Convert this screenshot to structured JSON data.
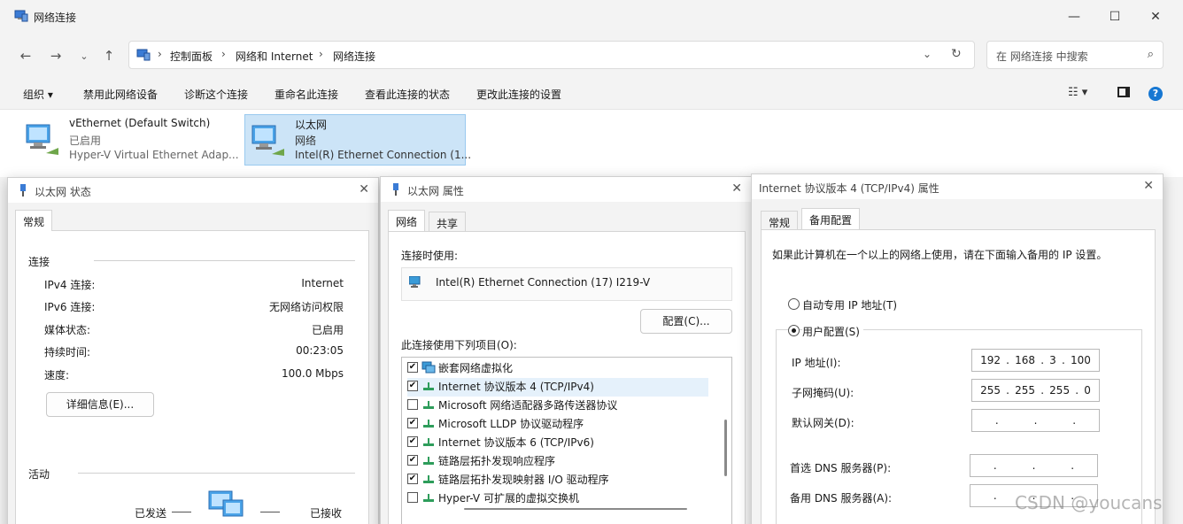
{
  "window": {
    "title": "网络连接",
    "minimize_icon": "minimize-icon",
    "maximize_icon": "maximize-icon",
    "close_icon": "close-icon"
  },
  "address": {
    "breadcrumbs": [
      "控制面板",
      "网络和 Internet",
      "网络连接"
    ],
    "search_placeholder": "在 网络连接 中搜索"
  },
  "toolbar": {
    "items": [
      "组织 ▾",
      "禁用此网络设备",
      "诊断这个连接",
      "重命名此连接",
      "查看此连接的状态",
      "更改此连接的设置"
    ]
  },
  "connections": [
    {
      "name": "vEthernet (Default Switch)",
      "status": "已启用",
      "device": "Hyper-V Virtual Ethernet Adap..."
    },
    {
      "name": "以太网",
      "status": "网络",
      "device": "Intel(R) Ethernet Connection (1..."
    }
  ],
  "status_dialog": {
    "title": "以太网 状态",
    "tab": "常规",
    "connection_group": "连接",
    "rows": [
      {
        "label": "IPv4 连接:",
        "value": "Internet"
      },
      {
        "label": "IPv6 连接:",
        "value": "无网络访问权限"
      },
      {
        "label": "媒体状态:",
        "value": "已启用"
      },
      {
        "label": "持续时间:",
        "value": "00:23:05"
      },
      {
        "label": "速度:",
        "value": "100.0 Mbps"
      }
    ],
    "details_button": "详细信息(E)...",
    "activity_group": "活动",
    "sent_label": "已发送",
    "received_label": "已接收"
  },
  "properties_dialog": {
    "title": "以太网 属性",
    "tabs": [
      "网络",
      "共享"
    ],
    "connect_using_label": "连接时使用:",
    "adapter": "Intel(R) Ethernet Connection (17) I219-V",
    "configure_button": "配置(C)...",
    "items_label": "此连接使用下列项目(O):",
    "items": [
      {
        "checked": true,
        "label": "嵌套网络虚拟化"
      },
      {
        "checked": true,
        "label": "Internet 协议版本 4 (TCP/IPv4)"
      },
      {
        "checked": false,
        "label": "Microsoft 网络适配器多路传送器协议"
      },
      {
        "checked": true,
        "label": "Microsoft LLDP 协议驱动程序"
      },
      {
        "checked": true,
        "label": "Internet 协议版本 6 (TCP/IPv6)"
      },
      {
        "checked": true,
        "label": "链路层拓扑发现响应程序"
      },
      {
        "checked": true,
        "label": "链路层拓扑发现映射器 I/O 驱动程序"
      },
      {
        "checked": false,
        "label": "Hyper-V 可扩展的虚拟交换机"
      }
    ]
  },
  "ipv4_dialog": {
    "title": "Internet 协议版本 4 (TCP/IPv4) 属性",
    "tabs": [
      "常规",
      "备用配置"
    ],
    "description": "如果此计算机在一个以上的网络上使用，请在下面输入备用的 IP 设置。",
    "auto_option": "自动专用 IP 地址(T)",
    "user_option": "用户配置(S)",
    "fields": [
      {
        "label": "IP 地址(I):",
        "octets": [
          "192",
          "168",
          "3",
          "100"
        ]
      },
      {
        "label": "子网掩码(U):",
        "octets": [
          "255",
          "255",
          "255",
          "0"
        ]
      },
      {
        "label": "默认网关(D):",
        "octets": [
          "",
          "",
          "",
          ""
        ]
      },
      {
        "label": "首选 DNS 服务器(P):",
        "octets": [
          "",
          "",
          "",
          ""
        ]
      },
      {
        "label": "备用 DNS 服务器(A):",
        "octets": [
          "",
          "",
          "",
          ""
        ]
      }
    ]
  },
  "watermark": "CSDN @youcans"
}
